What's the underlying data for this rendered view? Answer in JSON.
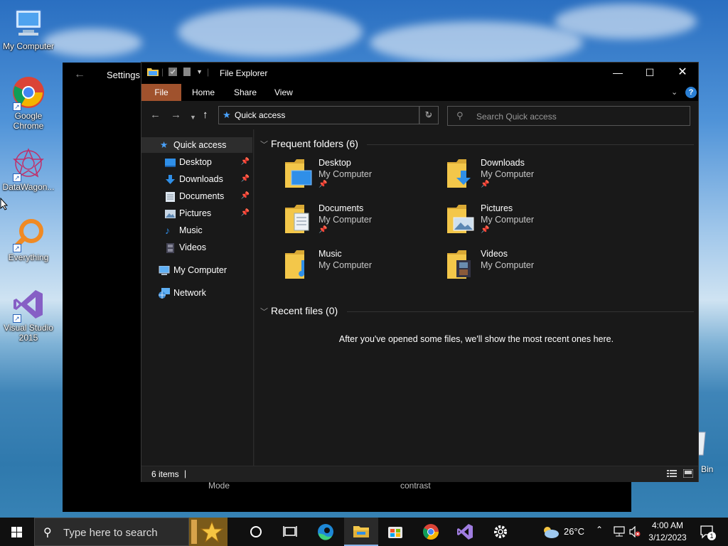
{
  "desktop": {
    "icons": [
      {
        "label": "My Computer"
      },
      {
        "label": "Google Chrome"
      },
      {
        "label": "DataWagon..."
      },
      {
        "label": "Everything"
      },
      {
        "label": "Visual Studio 2015"
      }
    ],
    "recycle_bin_label": "Bin"
  },
  "settings_window": {
    "title": "Settings",
    "mode_label": "Mode",
    "contrast_label": "contrast"
  },
  "explorer": {
    "title": "File Explorer",
    "ribbon_tabs": [
      "File",
      "Home",
      "Share",
      "View"
    ],
    "address": "Quick access",
    "search_placeholder": "Search Quick access",
    "nav": {
      "quick_access": "Quick access",
      "items": [
        {
          "label": "Desktop",
          "pinned": true
        },
        {
          "label": "Downloads",
          "pinned": true
        },
        {
          "label": "Documents",
          "pinned": true
        },
        {
          "label": "Pictures",
          "pinned": true
        },
        {
          "label": "Music",
          "pinned": false
        },
        {
          "label": "Videos",
          "pinned": false
        }
      ],
      "my_computer": "My Computer",
      "network": "Network"
    },
    "frequent_header": "Frequent folders (6)",
    "folders": [
      {
        "name": "Desktop",
        "location": "My Computer",
        "pinned": true
      },
      {
        "name": "Downloads",
        "location": "My Computer",
        "pinned": true
      },
      {
        "name": "Documents",
        "location": "My Computer",
        "pinned": true
      },
      {
        "name": "Pictures",
        "location": "My Computer",
        "pinned": true
      },
      {
        "name": "Music",
        "location": "My Computer",
        "pinned": false
      },
      {
        "name": "Videos",
        "location": "My Computer",
        "pinned": false
      }
    ],
    "recent_header": "Recent files (0)",
    "recent_message": "After you've opened some files, we'll show the most recent ones here.",
    "status_count": "6 items"
  },
  "taskbar": {
    "search_placeholder": "Type here to search",
    "weather": "26°C",
    "time": "4:00 AM",
    "date": "3/12/2023",
    "notification_count": "1"
  },
  "colors": {
    "file_tab": "#a0522d",
    "accent_blue": "#4aa3ff",
    "folder_yellow": "#f3c74a"
  }
}
